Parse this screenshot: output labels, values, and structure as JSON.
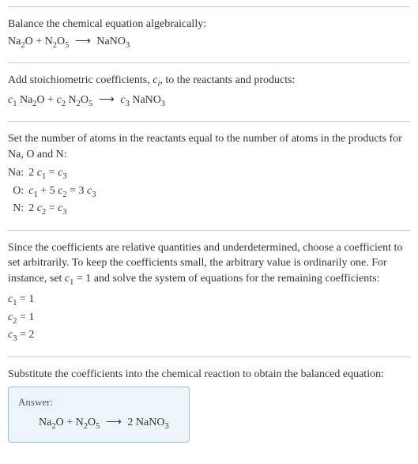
{
  "section1": {
    "heading": "Balance the chemical equation algebraically:",
    "equation_html": "Na<span class=\"sub\">2</span>O + N<span class=\"sub\">2</span>O<span class=\"sub\">5</span>  <span class=\"arrow\">⟶</span>  NaNO<span class=\"sub\">3</span>"
  },
  "section2": {
    "heading_html": "Add stoichiometric coefficients, <span class=\"italic\">c<span class=\"sub\">i</span></span>, to the reactants and products:",
    "equation_html": "<span class=\"italic\">c</span><span class=\"sub\">1</span> Na<span class=\"sub\">2</span>O + <span class=\"italic\">c</span><span class=\"sub\">2</span> N<span class=\"sub\">2</span>O<span class=\"sub\">5</span>  <span class=\"arrow\">⟶</span>  <span class=\"italic\">c</span><span class=\"sub\">3</span> NaNO<span class=\"sub\">3</span>"
  },
  "section3": {
    "heading": "Set the number of atoms in the reactants equal to the number of atoms in the products for Na, O and N:",
    "rows": [
      {
        "label": "Na:",
        "eq_html": "2 <span class=\"italic\">c</span><span class=\"sub\">1</span> = <span class=\"italic\">c</span><span class=\"sub\">3</span>"
      },
      {
        "label": "O:",
        "eq_html": "<span class=\"italic\">c</span><span class=\"sub\">1</span> + 5 <span class=\"italic\">c</span><span class=\"sub\">2</span> = 3 <span class=\"italic\">c</span><span class=\"sub\">3</span>"
      },
      {
        "label": "N:",
        "eq_html": "2 <span class=\"italic\">c</span><span class=\"sub\">2</span> = <span class=\"italic\">c</span><span class=\"sub\">3</span>"
      }
    ]
  },
  "section4": {
    "heading_html": "Since the coefficients are relative quantities and underdetermined, choose a coefficient to set arbitrarily. To keep the coefficients small, the arbitrary value is ordinarily one. For instance, set <span class=\"italic\">c</span><span class=\"sub\">1</span> = 1 and solve the system of equations for the remaining coefficients:",
    "coeffs": [
      "<span class=\"italic\">c</span><span class=\"sub\">1</span> = 1",
      "<span class=\"italic\">c</span><span class=\"sub\">2</span> = 1",
      "<span class=\"italic\">c</span><span class=\"sub\">3</span> = 2"
    ]
  },
  "section5": {
    "heading": "Substitute the coefficients into the chemical reaction to obtain the balanced equation:",
    "answer_label": "Answer:",
    "answer_html": "Na<span class=\"sub\">2</span>O + N<span class=\"sub\">2</span>O<span class=\"sub\">5</span>  <span class=\"arrow\">⟶</span>  2 NaNO<span class=\"sub\">3</span>"
  },
  "chart_data": {
    "type": "table",
    "title": "Balancing Na2O + N2O5 -> NaNO3",
    "atom_balance": [
      {
        "element": "Na",
        "equation": "2 c1 = c3"
      },
      {
        "element": "O",
        "equation": "c1 + 5 c2 = 3 c3"
      },
      {
        "element": "N",
        "equation": "2 c2 = c3"
      }
    ],
    "solution": {
      "c1": 1,
      "c2": 1,
      "c3": 2
    },
    "balanced_equation": "Na2O + N2O5 -> 2 NaNO3"
  }
}
